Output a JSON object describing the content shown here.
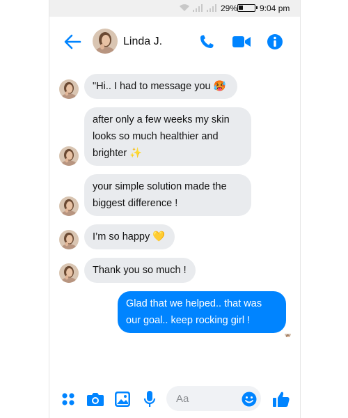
{
  "status_bar": {
    "battery_percent": "29%",
    "battery_level": 0.29,
    "time": "9:04 pm",
    "icons": [
      "wifi-icon",
      "signal-icon",
      "signal-icon",
      "battery-icon"
    ]
  },
  "header": {
    "contact_name": "Linda J.",
    "icons": [
      "back-arrow-icon",
      "avatar",
      "phone-call-icon",
      "video-call-icon",
      "info-icon"
    ]
  },
  "messages": [
    {
      "direction": "incoming",
      "lines": [
        "\"Hi.. I had to message you 🥵"
      ],
      "emoji": "hot-face-emoji"
    },
    {
      "direction": "incoming",
      "lines": [
        "after only a few weeks my skin",
        "looks so much healthier and",
        "brighter ✨"
      ],
      "emoji": "sparkles-emoji"
    },
    {
      "direction": "incoming",
      "lines": [
        "your simple solution made the",
        "biggest difference !"
      ]
    },
    {
      "direction": "incoming",
      "lines": [
        "I’m so happy 💛"
      ],
      "emoji": "yellow-heart-emoji"
    },
    {
      "direction": "incoming",
      "lines": [
        "Thank you so much !"
      ]
    },
    {
      "direction": "outgoing",
      "lines": [
        "Glad that we helped.. that was",
        "our goal.. keep rocking girl !"
      ]
    }
  ],
  "composer": {
    "placeholder": "Aa",
    "icons": [
      "apps-icon",
      "camera-icon",
      "gallery-icon",
      "microphone-icon",
      "emoji-icon",
      "thumbs-up-icon"
    ]
  },
  "colors": {
    "accent": "#0084ff",
    "incoming_bubble": "#e9ebee",
    "status_bar": "#f0f0f0"
  }
}
